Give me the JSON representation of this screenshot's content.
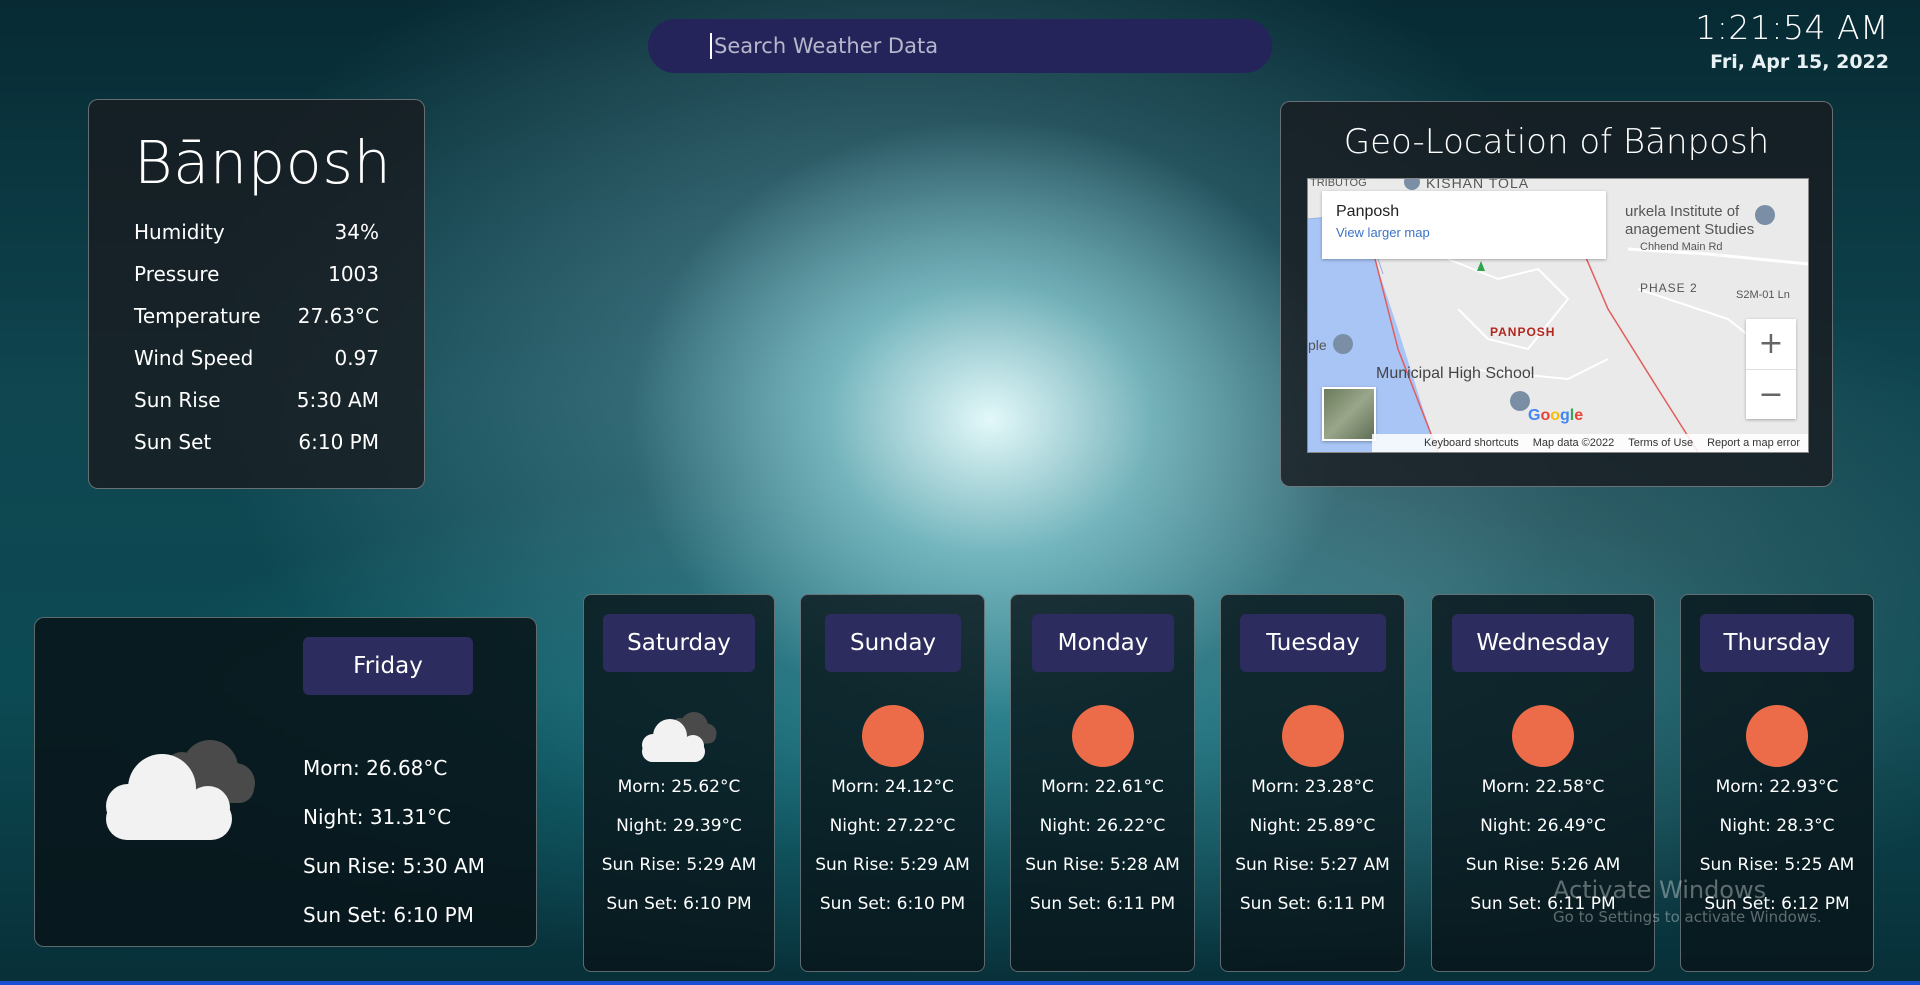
{
  "search": {
    "placeholder": "Search Weather Data"
  },
  "clock": {
    "time": "1:21:54 AM",
    "date": "Fri, Apr 15, 2022"
  },
  "city": {
    "name": "Bānposh",
    "stats": [
      {
        "label": "Humidity",
        "value": "34%"
      },
      {
        "label": "Pressure",
        "value": "1003"
      },
      {
        "label": "Temperature",
        "value": "27.63°C"
      },
      {
        "label": "Wind Speed",
        "value": "0.97"
      },
      {
        "label": "Sun Rise",
        "value": "5:30 AM"
      },
      {
        "label": "Sun Set",
        "value": "6:10 PM"
      }
    ]
  },
  "map": {
    "title": "Geo-Location of Bānposh",
    "popup_name": "Panposh",
    "popup_link": "View larger map",
    "labels": {
      "kishan_tola": "KISHAN TOLA",
      "ib_top": "TRIBUTOG",
      "institute1": "urkela Institute of",
      "institute2": "anagement Studies",
      "chhend": "Chhend Main Rd",
      "phase2": "PHASE 2",
      "s2m": "S2M-01 Ln",
      "panposh": "PANPOSH",
      "ple": "ple",
      "school": "Municipal High School"
    },
    "zoom_in": "+",
    "zoom_out": "−",
    "google": "Google",
    "footer": {
      "shortcuts": "Keyboard shortcuts",
      "mapdata": "Map data ©2022",
      "terms": "Terms of Use",
      "report": "Report a map error"
    },
    "colors": {
      "water": "#a9c5f5",
      "road": "#e35d5d"
    }
  },
  "today": {
    "day": "Friday",
    "icon": "cloud-icon",
    "morn": "Morn: 26.68°C",
    "night": "Night: 31.31°C",
    "sunrise": "Sun Rise: 5:30 AM",
    "sunset": "Sun Set: 6:10 PM"
  },
  "forecast": [
    {
      "day": "Saturday",
      "icon": "cloud-icon",
      "morn": "Morn:  25.62°C",
      "night": "Night:  29.39°C",
      "sunrise": "Sun Rise: 5:29 AM",
      "sunset": "Sun Set: 6:10 PM"
    },
    {
      "day": "Sunday",
      "icon": "sun-icon",
      "morn": "Morn:  24.12°C",
      "night": "Night:  27.22°C",
      "sunrise": "Sun Rise: 5:29 AM",
      "sunset": "Sun Set: 6:10 PM"
    },
    {
      "day": "Monday",
      "icon": "sun-icon",
      "morn": "Morn:  22.61°C",
      "night": "Night:  26.22°C",
      "sunrise": "Sun Rise: 5:28 AM",
      "sunset": "Sun Set: 6:11 PM"
    },
    {
      "day": "Tuesday",
      "icon": "sun-icon",
      "morn": "Morn:  23.28°C",
      "night": "Night:  25.89°C",
      "sunrise": "Sun Rise: 5:27 AM",
      "sunset": "Sun Set: 6:11 PM"
    },
    {
      "day": "Wednesday",
      "icon": "sun-icon",
      "morn": "Morn:  22.58°C",
      "night": "Night:  26.49°C",
      "sunrise": "Sun Rise: 5:26 AM",
      "sunset": "Sun Set: 6:11 PM"
    },
    {
      "day": "Thursday",
      "icon": "sun-icon",
      "morn": "Morn:  22.93°C",
      "night": "Night:  28.3°C",
      "sunrise": "Sun Rise: 5:25 AM",
      "sunset": "Sun Set: 6:12 PM"
    }
  ],
  "colors": {
    "accent_pill": "#2c2c5e",
    "sun": "#ec6c4a",
    "search_bg": "#24245a"
  },
  "watermark": {
    "line1": "Activate Windows",
    "line2": "Go to Settings to activate Windows."
  }
}
